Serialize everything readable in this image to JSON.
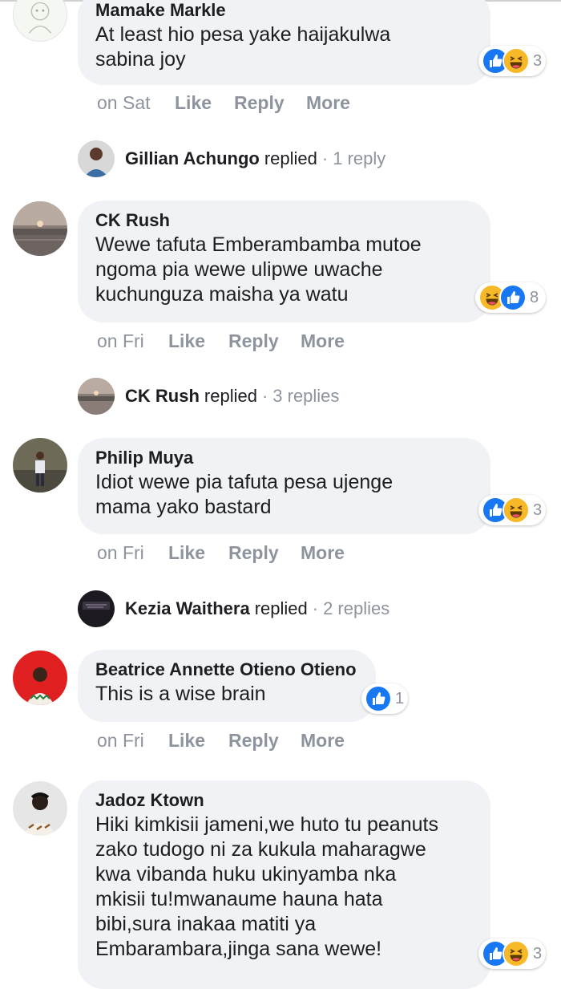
{
  "comments": [
    {
      "author": "Mamake Markle",
      "text": "At least hio pesa yake haijakulwa\nsabina joy",
      "date": "on Sat",
      "like": "Like",
      "reply": "Reply",
      "more": "More",
      "reaction_count": "3",
      "reactions": [
        "like-icon",
        "haha-icon"
      ]
    },
    {
      "author": "CK Rush",
      "text": "Wewe tafuta Emberambamba mutoe\nngoma pia wewe ulipwe uwache\nkuchunguza maisha ya watu",
      "date": "on Fri",
      "like": "Like",
      "reply": "Reply",
      "more": "More",
      "reaction_count": "8",
      "reactions": [
        "haha-icon",
        "like-icon"
      ]
    },
    {
      "author": "Philip Muya",
      "text": "Idiot wewe pia tafuta pesa ujenge\nmama yako bastard",
      "date": "on Fri",
      "like": "Like",
      "reply": "Reply",
      "more": "More",
      "reaction_count": "3",
      "reactions": [
        "like-icon",
        "haha-icon"
      ]
    },
    {
      "author": "Beatrice Annette Otieno Otieno",
      "text": "This is a wise brain",
      "date": "on Fri",
      "like": "Like",
      "reply": "Reply",
      "more": "More",
      "reaction_count": "1",
      "reactions": [
        "like-icon"
      ]
    },
    {
      "author": "Jadoz Ktown",
      "text": "Hiki kimkisii jameni,we huto tu peanuts\nzako tudogo ni za kukula maharagwe\nkwa vibanda huku ukinyamba nka\nmkisii tu!mwanaume hauna hata\nbibi,sura inakaa matiti ya\nEmbarambara,jinga sana wewe!",
      "reaction_count": "3",
      "reactions": [
        "like-icon",
        "haha-icon"
      ]
    }
  ],
  "replies": [
    {
      "name": "Gillian Achungo",
      "verb": "replied",
      "dot": "·",
      "count": "1 reply"
    },
    {
      "name": "CK Rush",
      "verb": "replied",
      "dot": "·",
      "count": "3 replies"
    },
    {
      "name": "Kezia Waithera",
      "verb": "replied",
      "dot": "·",
      "count": "2 replies"
    }
  ],
  "colors": {
    "bubble": "#f0f2f5",
    "like_blue": "#1877f2",
    "haha_yellow": "#f7b928",
    "meta_gray": "#8d949e",
    "avatar_red": "#e02020"
  }
}
